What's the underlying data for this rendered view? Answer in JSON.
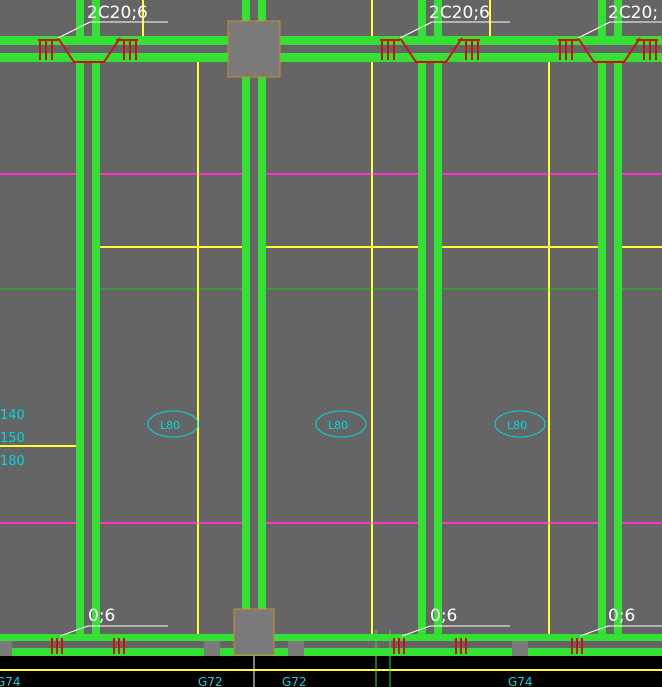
{
  "drawing": {
    "colors": {
      "background": "#656565",
      "beam": "#35e035",
      "beam_center": "#ffffff",
      "yellow_line": "#ffff33",
      "magenta_line": "#ff33cc",
      "thin_green": "#20c020",
      "rebar_red": "#d01010",
      "column": "#7a7a7a",
      "column_edge": "#d08a30",
      "label_white": "#ffffff",
      "label_cyan": "#00d8e0",
      "bottom_band": "#000000"
    },
    "top_rebar_labels": [
      "2C20;6",
      "2C20;6",
      "2C20;"
    ],
    "bottom_rebar_labels": [
      "0;6",
      "0;6",
      "0;6"
    ],
    "slab_labels": [
      "L80",
      "L80",
      "L80"
    ],
    "left_notes": [
      "140",
      "150",
      "180"
    ],
    "bottom_axis_labels": [
      "G74",
      "G72",
      "G72",
      "G74"
    ]
  }
}
